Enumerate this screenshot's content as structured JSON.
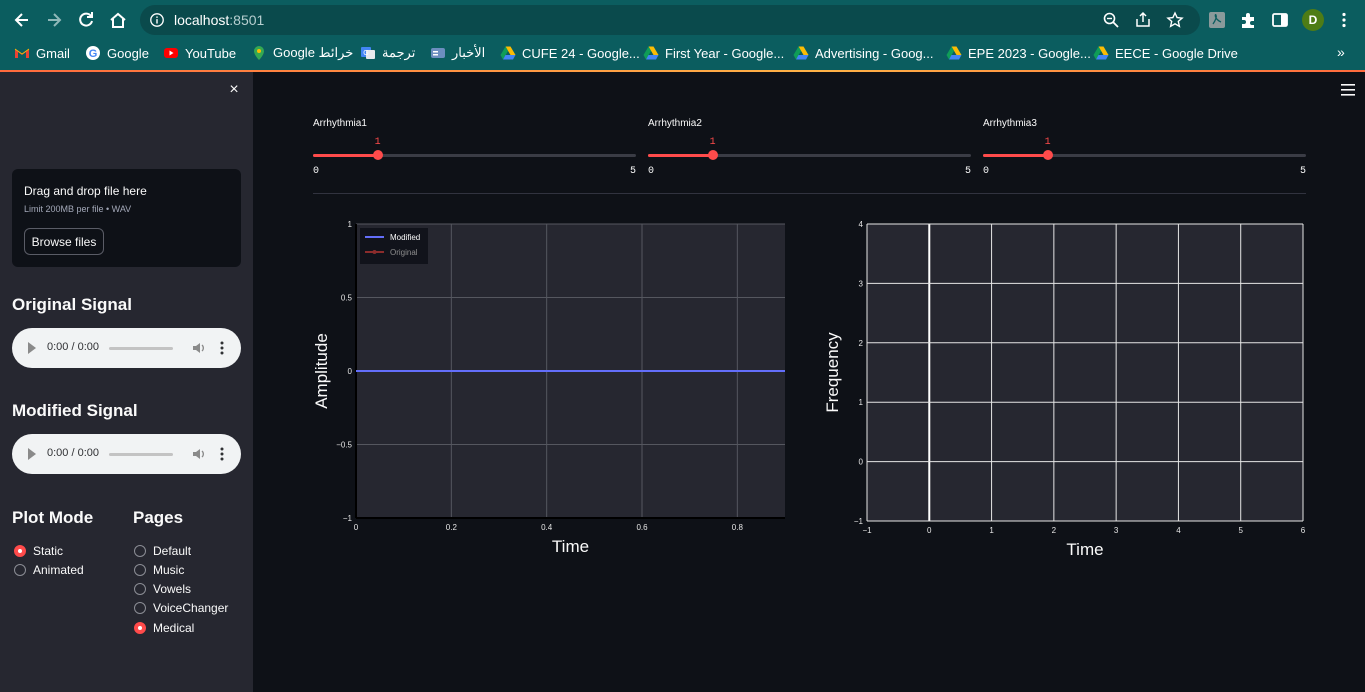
{
  "browser": {
    "url_host": "localhost",
    "url_port": ":8501",
    "profile_initial": "D",
    "bookmarks": [
      {
        "label": "Gmail",
        "icon": "gmail-icon"
      },
      {
        "label": "Google",
        "icon": "google-icon"
      },
      {
        "label": "YouTube",
        "icon": "youtube-icon"
      },
      {
        "label": "Google خرائط",
        "icon": "maps-icon"
      },
      {
        "label": "ترجمة",
        "icon": "translate-icon"
      },
      {
        "label": "الأخبار",
        "icon": "news-icon"
      },
      {
        "label": "CUFE 24 - Google...",
        "icon": "drive-icon"
      },
      {
        "label": "First Year  - Google...",
        "icon": "drive-icon"
      },
      {
        "label": "Advertising  - Goog...",
        "icon": "drive-icon"
      },
      {
        "label": "EPE 2023 - Google...",
        "icon": "drive-icon"
      },
      {
        "label": "EECE - Google Drive",
        "icon": "drive-icon"
      }
    ],
    "overflow_label": "»"
  },
  "sidebar": {
    "close_label": "×",
    "uploader": {
      "title": "Drag and drop file here",
      "limit": "Limit 200MB per file • WAV",
      "button": "Browse files"
    },
    "original_signal_title": "Original Signal",
    "modified_signal_title": "Modified Signal",
    "audio_time": "0:00 / 0:00",
    "plot_mode": {
      "title": "Plot Mode",
      "options": [
        "Static",
        "Animated"
      ],
      "selected": "Static"
    },
    "pages": {
      "title": "Pages",
      "options": [
        "Default",
        "Music",
        "Vowels",
        "VoiceChanger",
        "Medical"
      ],
      "selected": "Medical"
    }
  },
  "sliders": [
    {
      "label": "Arrhythmia1",
      "value": 1,
      "min": 0,
      "max": 5
    },
    {
      "label": "Arrhythmia2",
      "value": 1,
      "min": 0,
      "max": 5
    },
    {
      "label": "Arrhythmia3",
      "value": 1,
      "min": 0,
      "max": 5
    }
  ],
  "colors": {
    "accent": "#ff4b4b",
    "modified_line": "#636efa",
    "original_line": "#8b2c2c",
    "plot_bg": "#262730"
  },
  "chart_data": [
    {
      "type": "line",
      "xlabel": "Time",
      "ylabel": "Amplitude",
      "xlim": [
        0,
        0.9
      ],
      "ylim": [
        -1,
        1
      ],
      "x_ticks": [
        "0",
        "0.2",
        "0.4",
        "0.6",
        "0.8"
      ],
      "y_ticks": [
        "−1",
        "−0.5",
        "0",
        "0.5",
        "1"
      ],
      "legend": "top-left",
      "grid": true,
      "series": [
        {
          "name": "Modified",
          "x": [
            0,
            0.9
          ],
          "y": [
            0,
            0
          ],
          "style": "line"
        },
        {
          "name": "Original",
          "x": [],
          "y": [],
          "style": "lines+markers"
        }
      ]
    },
    {
      "type": "line",
      "xlabel": "Time",
      "ylabel": "Frequency",
      "xlim": [
        -1,
        6
      ],
      "ylim": [
        -1,
        4
      ],
      "x_ticks": [
        "−1",
        "0",
        "1",
        "2",
        "3",
        "4",
        "5",
        "6"
      ],
      "y_ticks": [
        "−1",
        "0",
        "1",
        "2",
        "3",
        "4"
      ],
      "grid": true,
      "series": []
    }
  ]
}
